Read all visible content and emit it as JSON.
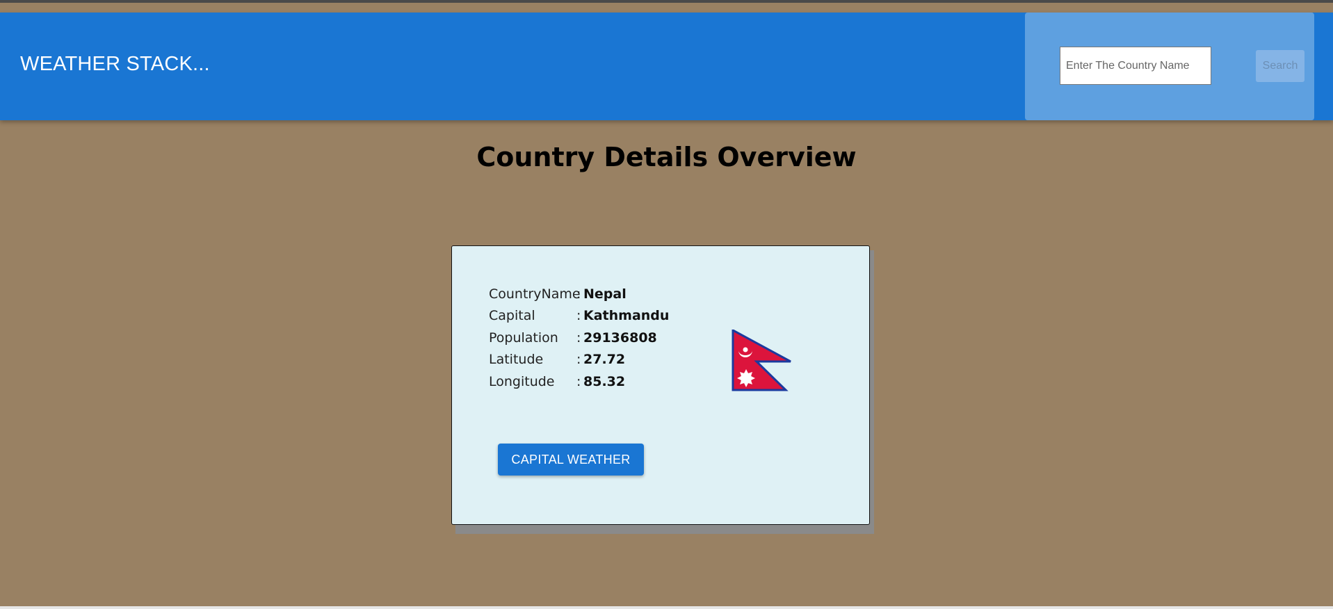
{
  "appbar": {
    "brand": "WEATHER STACK...",
    "search": {
      "placeholder": "Enter The Country Name",
      "value": ""
    },
    "search_button_label": "Search",
    "colors": {
      "bar": "#1a76d3",
      "panel": "#5ea0e0"
    }
  },
  "main": {
    "title": "Country Details Overview",
    "background": "#998163",
    "card": {
      "rows": [
        {
          "label": "CountryName",
          "value": "Nepal"
        },
        {
          "label": "Capital",
          "value": "Kathmandu"
        },
        {
          "label": "Population",
          "value": "29136808"
        },
        {
          "label": "Latitude",
          "value": "27.72"
        },
        {
          "label": "Longitude",
          "value": "85.32"
        }
      ],
      "separator": ":",
      "flag_icon": "nepal-flag",
      "button_label": "CAPITAL WEATHER"
    }
  }
}
